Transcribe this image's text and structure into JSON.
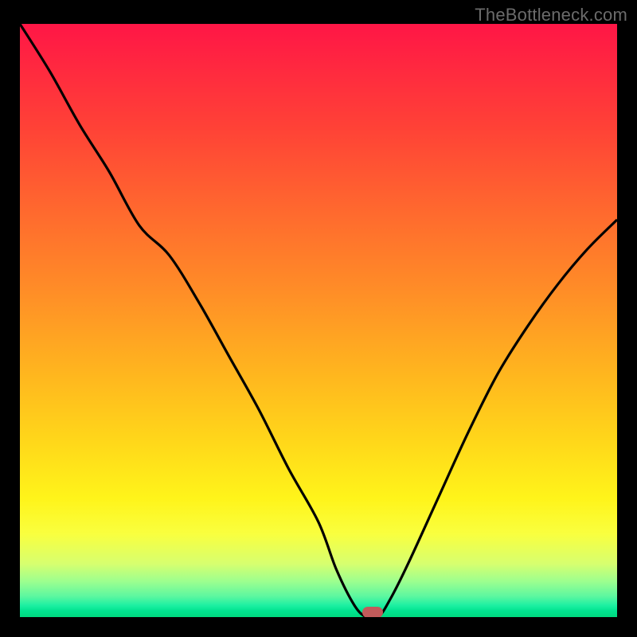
{
  "watermark": "TheBottleneck.com",
  "colors": {
    "frame_bg": "#000000",
    "curve": "#000000",
    "minpoint": "#c25b5b",
    "gradient_top": "#ff1646",
    "gradient_bottom": "#00d97f"
  },
  "chart_data": {
    "type": "line",
    "title": "",
    "xlabel": "",
    "ylabel": "",
    "xlim": [
      0,
      100
    ],
    "ylim": [
      0,
      100
    ],
    "gradient_description": "Vertical gradient from red (top, high bottleneck) through orange and yellow to bright green (bottom, low bottleneck)",
    "series": [
      {
        "name": "bottleneck-curve",
        "x": [
          0,
          5,
          10,
          15,
          20,
          25,
          30,
          35,
          40,
          45,
          50,
          53,
          56,
          58,
          60,
          62,
          65,
          70,
          75,
          80,
          85,
          90,
          95,
          100
        ],
        "y": [
          100,
          92,
          83,
          75,
          66,
          61,
          53,
          44,
          35,
          25,
          16,
          8,
          2,
          0,
          0,
          3,
          9,
          20,
          31,
          41,
          49,
          56,
          62,
          67
        ]
      }
    ],
    "min_marker": {
      "name": "minimum-bottleneck-point",
      "x": 59,
      "y": 0
    }
  }
}
